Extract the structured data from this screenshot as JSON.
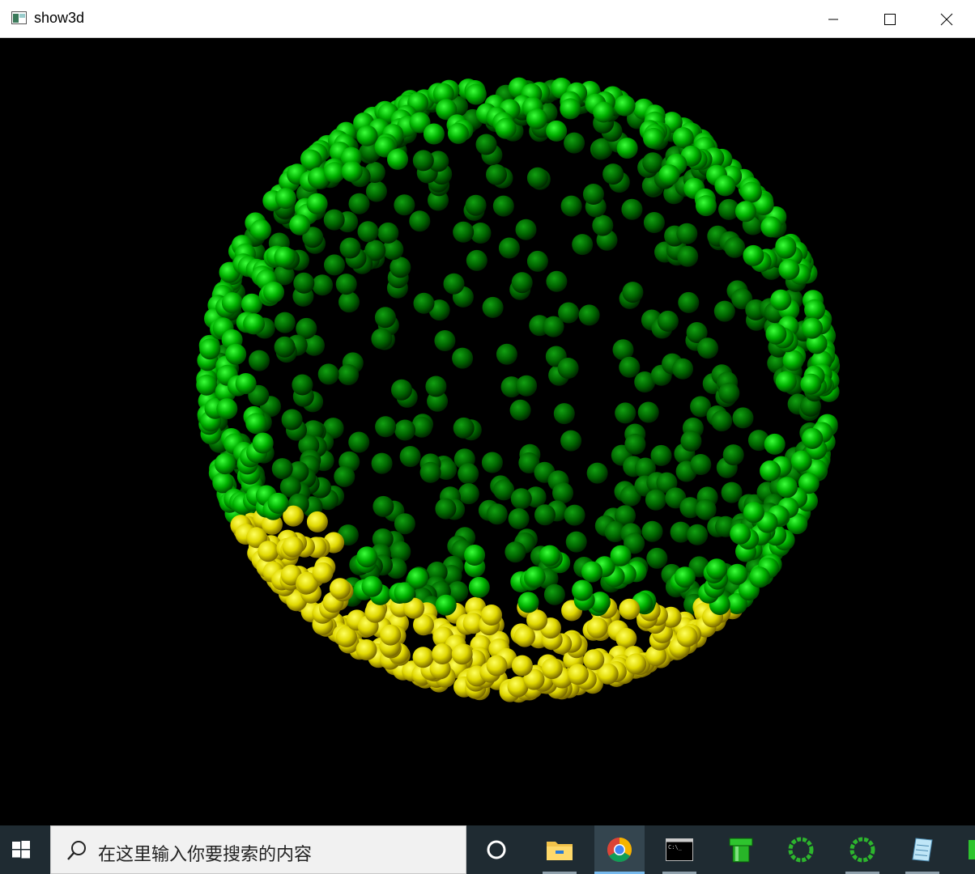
{
  "window": {
    "title": "show3d"
  },
  "taskbar": {
    "search_placeholder": "在这里输入你要搜索的内容",
    "apps": [
      {
        "name": "cortana"
      },
      {
        "name": "file-explorer"
      },
      {
        "name": "chrome"
      },
      {
        "name": "command-prompt"
      },
      {
        "name": "pipe-app"
      },
      {
        "name": "ring-app-1"
      },
      {
        "name": "ring-app-2"
      },
      {
        "name": "notepad"
      },
      {
        "name": "green-app"
      }
    ]
  },
  "colors": {
    "sphere_green": "#00b000",
    "sphere_yellow": "#e0d800",
    "background": "#000000",
    "taskbar": "#1f2b32"
  }
}
